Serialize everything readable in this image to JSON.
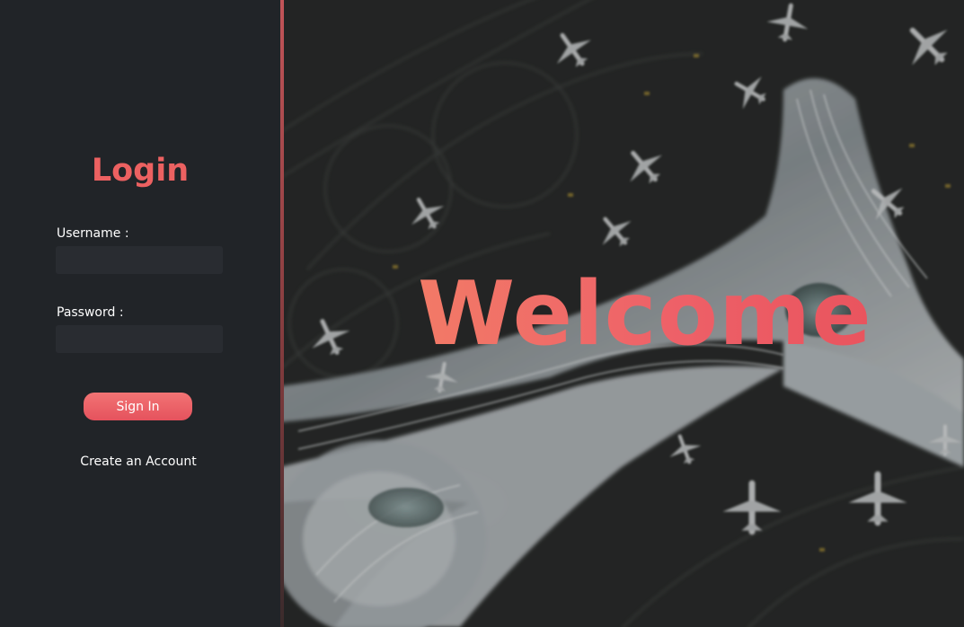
{
  "login": {
    "title": "Login",
    "username_label": "Username :",
    "username_value": "",
    "password_label": "Password :",
    "password_value": "",
    "sign_in_label": "Sign In",
    "create_account_label": "Create an Account"
  },
  "hero": {
    "welcome_text": "Welcome",
    "background_image": "aerial-airport-terminal-with-airplanes"
  },
  "colors": {
    "accent": "#ec6161",
    "panel_bg": "#212428",
    "input_bg": "#292c31",
    "text": "#ffffff"
  }
}
